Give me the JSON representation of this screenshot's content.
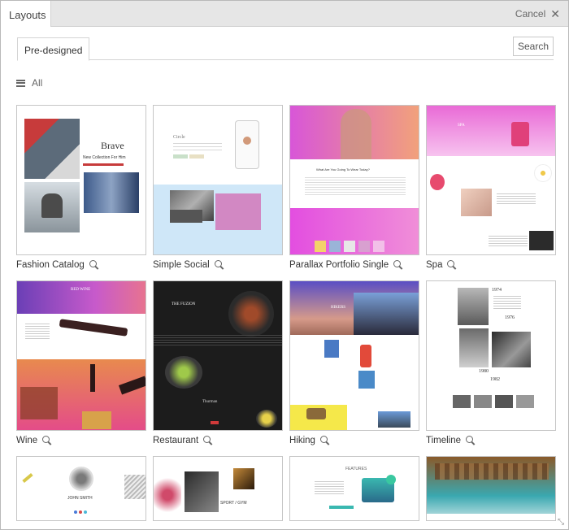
{
  "window": {
    "title": "Layouts",
    "cancel_label": "Cancel"
  },
  "tabs": [
    {
      "label": "Pre-designed",
      "active": true
    }
  ],
  "search": {
    "label": "Search"
  },
  "filter": {
    "label": "All"
  },
  "layouts": [
    {
      "name": "Fashion Catalog"
    },
    {
      "name": "Simple Social"
    },
    {
      "name": "Parallax Portfolio Single"
    },
    {
      "name": "Spa"
    },
    {
      "name": "Wine"
    },
    {
      "name": "Restaurant"
    },
    {
      "name": "Hiking"
    },
    {
      "name": "Timeline"
    },
    {
      "name": ""
    },
    {
      "name": ""
    },
    {
      "name": ""
    },
    {
      "name": ""
    }
  ],
  "preview_text": {
    "fashion_title": "Brave",
    "fashion_sub": "New Collection For Him",
    "wine_title": "RED WINE",
    "restaurant_title": "THE FUZION",
    "restaurant_sub": "Thurman",
    "hiking_title": "HIKERS",
    "timeline_y1": "1974",
    "timeline_y2": "1976",
    "timeline_y3": "1980",
    "timeline_y4": "1982",
    "person_name": "JOHN SMITH",
    "sport_title": "SPORT / GYM",
    "features_title": "FEATURES",
    "social_title": "Circle",
    "spa_title": "SPA",
    "parallax_q": "What Are You Going To Wear Today?"
  }
}
